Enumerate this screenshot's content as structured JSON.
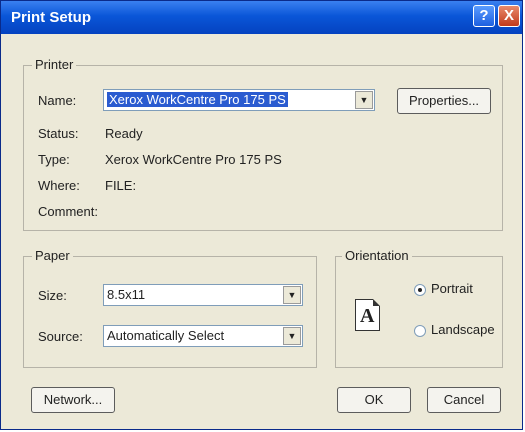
{
  "window": {
    "title": "Print Setup",
    "help_glyph": "?",
    "close_glyph": "X"
  },
  "printer": {
    "group_label": "Printer",
    "name_label": "Name:",
    "name_value": "Xerox WorkCentre Pro 175 PS",
    "properties_label": "Properties...",
    "status_label": "Status:",
    "status_value": "Ready",
    "type_label": "Type:",
    "type_value": "Xerox WorkCentre Pro 175 PS",
    "where_label": "Where:",
    "where_value": "FILE:",
    "comment_label": "Comment:"
  },
  "paper": {
    "group_label": "Paper",
    "size_label": "Size:",
    "size_value": "8.5x11",
    "source_label": "Source:",
    "source_value": "Automatically Select"
  },
  "orientation": {
    "group_label": "Orientation",
    "portrait_label": "Portrait",
    "landscape_label": "Landscape",
    "selected": "Portrait",
    "page_letter": "A"
  },
  "buttons": {
    "network_label": "Network...",
    "ok_label": "OK",
    "cancel_label": "Cancel"
  },
  "icons": {
    "dropdown_arrow": "▼"
  }
}
